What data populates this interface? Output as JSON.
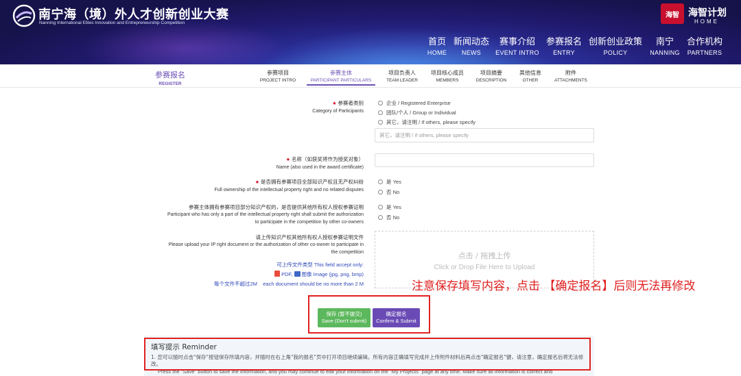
{
  "header": {
    "logo_cn": "南宁海（境）外人才创新创业大赛",
    "logo_en": "Nanning International Elites Innovation and Entrepreneurship Competition",
    "brand_seal": "海智",
    "brand_cn": "海智计划",
    "brand_en": "HOME",
    "nav": [
      {
        "cn": "首页",
        "en": "HOME"
      },
      {
        "cn": "新闻动态",
        "en": "NEWS"
      },
      {
        "cn": "赛事介绍",
        "en": "EVENT INTRO"
      },
      {
        "cn": "参赛报名",
        "en": "ENTRY"
      },
      {
        "cn": "创新创业政策",
        "en": "POLICY"
      },
      {
        "cn": "南宁",
        "en": "NANNING"
      },
      {
        "cn": "合作机构",
        "en": "PARTNERS"
      }
    ]
  },
  "tabbar": {
    "section_cn": "参赛报名",
    "section_en": "REGISTER",
    "tabs": [
      {
        "cn": "参赛项目",
        "en": "PROJECT INTRO"
      },
      {
        "cn": "参赛主体",
        "en": "PARTICIPANT PARTICULARS"
      },
      {
        "cn": "项目负责人",
        "en": "TEAM LEADER"
      },
      {
        "cn": "项目核心成员",
        "en": "MEMBERS"
      },
      {
        "cn": "项目摘要",
        "en": "DESCRIPTION"
      },
      {
        "cn": "其他信息",
        "en": "OTHER"
      },
      {
        "cn": "附件",
        "en": "ATTACHMENTS"
      }
    ],
    "active_tab": "PARTICIPANT PARTICULARS"
  },
  "form": {
    "category": {
      "label_cn": "参赛者类别",
      "label_en": "Category of Participants",
      "options": [
        "企业 / Registered Enterprise",
        "团队/个人 / Group or Individual",
        "其它，请注明 / If others, please specify"
      ],
      "other_placeholder": "其它，请注明 / If others, please specify"
    },
    "name": {
      "label_cn": "名称（如获奖将作为授奖对象）",
      "label_en": "Name (also used in the award certificate)",
      "value": ""
    },
    "full_ownership": {
      "label_cn": "是否拥有参赛项目全部知识产权且无产权纠纷",
      "label_en": "Full ownership of the intellectual property right and no related disputes",
      "options": [
        "是 Yes",
        "否 No"
      ]
    },
    "partial_ownership": {
      "label_cn": "参赛主体拥有参赛项目部分知识产权的，是否提供其他所有权人授权参赛证明",
      "label_en_1": "Participant who has only a part of the intellectual property right shall submit the authorization",
      "label_en_2": "to participate in the competition by other co-owners",
      "options": [
        "是 Yes",
        "否 No"
      ]
    },
    "upload": {
      "label_cn": "请上传知识产权其他所有权人授权参赛证明文件",
      "label_en_1": "Please upload your IP right document or the authorization of other co-owner to participate in",
      "label_en_2": "the competition",
      "drop_cn": "点击 / 拖拽上传",
      "drop_en": "Click or Drop File Here to Upload",
      "types_title": "可上传文件类型 This field accept only:",
      "type_pdf": "PDF,",
      "type_img": "图像 Image (jpg, png, bmp)",
      "size_limit": "每个文件不超过2M    each document should be no more than 2 M"
    }
  },
  "notice": "注意保存填写内容，点击 【确定报名】后则无法再修改",
  "buttons": {
    "save_cn": "保存 (暂不提交)",
    "save_en": "Save (Don't submit)",
    "submit_cn": "确定报名",
    "submit_en": "Confirm & Submit"
  },
  "reminder": {
    "title": "填写提示 Reminder",
    "line1": "1. 您可以随时点击\"保存\"按钮保存所填内容，并随时在右上角\"我的报名\"页中打开项目继续编辑。所有内容正确填写完成并上传附件材料后再点击\"确定报名\"键，请注意，确定报名后将无法修改。",
    "line2": "Press the \"Save\" button to save the information, and you may continue to edit your information on the \"My Projects\" page at any time. Make sure all information is correct and"
  },
  "colors": {
    "accent": "#6b4fb6",
    "save_button": "#5cb85c",
    "submit_button": "#6a4bb5",
    "annotation_red": "#e02020",
    "required_star": "#d0021b"
  }
}
